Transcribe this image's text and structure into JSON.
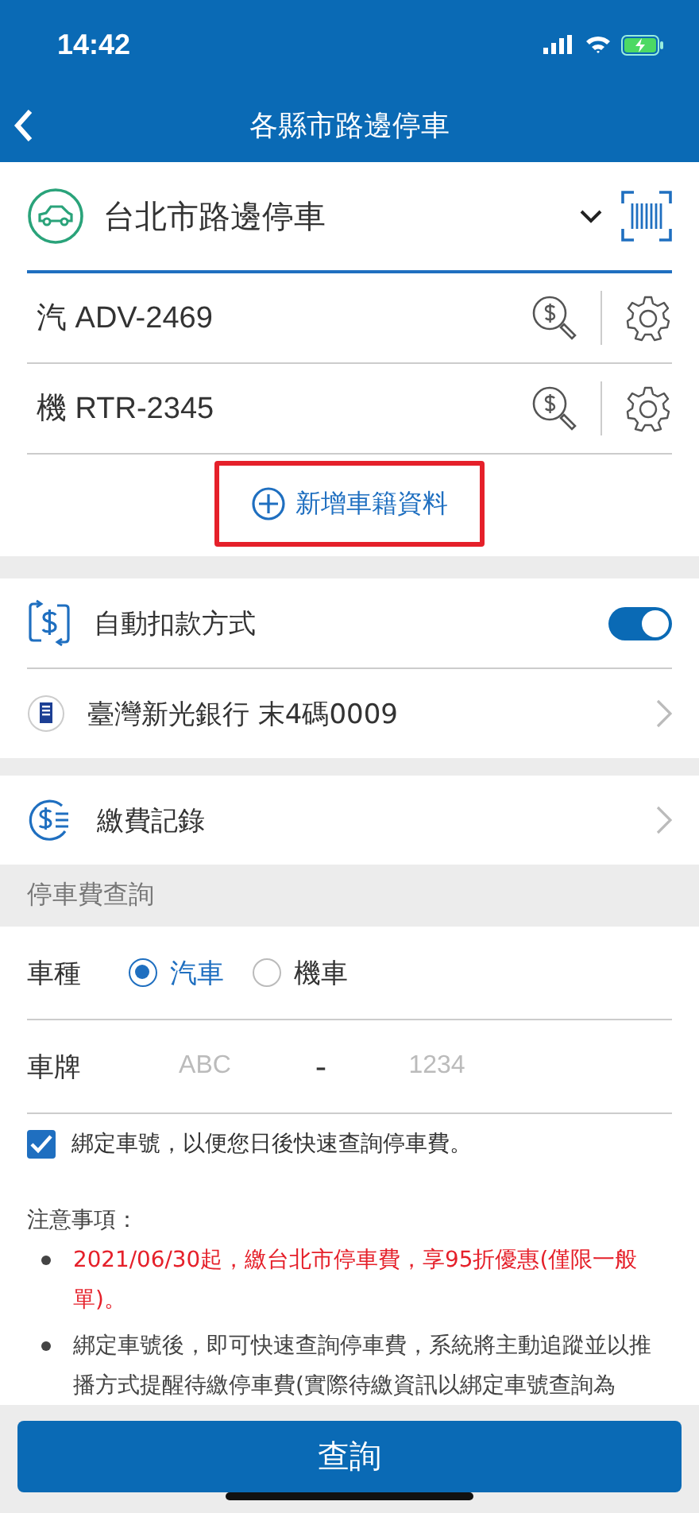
{
  "status_bar": {
    "time": "14:42"
  },
  "header": {
    "title": "各縣市路邊停車"
  },
  "city_selector": {
    "value": "台北市路邊停車"
  },
  "vehicles": [
    {
      "label": "汽 ADV-2469"
    },
    {
      "label": "機 RTR-2345"
    }
  ],
  "add_vehicle": {
    "label": "新增車籍資料",
    "highlighted": true
  },
  "auto_pay": {
    "label": "自動扣款方式",
    "on": true
  },
  "bank": {
    "label": "臺灣新光銀行 末4碼0009"
  },
  "records": {
    "label": "繳費記錄"
  },
  "query": {
    "section_title": "停車費查詢",
    "type_label": "車種",
    "types": [
      {
        "label": "汽車",
        "selected": true
      },
      {
        "label": "機車",
        "selected": false
      }
    ],
    "plate_label": "車牌",
    "plate_placeholder_1": "ABC",
    "separator": "-",
    "plate_placeholder_2": "1234",
    "bind": {
      "label": "綁定車號，以便您日後快速查詢停車費。",
      "checked": true
    }
  },
  "notes": {
    "title": "注意事項：",
    "items": [
      {
        "text": "2021/06/30起，繳台北市停車費，享95折優惠(僅限一般單)。",
        "kind": "warning"
      },
      {
        "text": "綁定車號後，即可快速查詢停車費，系統將主動追蹤並以推播方式提醒待繳停車費(實際待繳資訊以綁定車號查詢為",
        "kind": "normal"
      }
    ]
  },
  "submit": {
    "label": "查詢"
  }
}
